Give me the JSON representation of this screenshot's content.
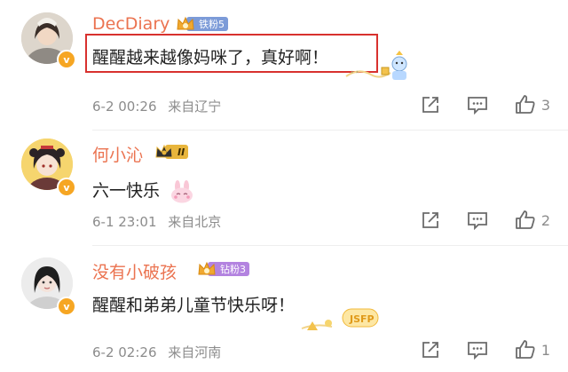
{
  "comments": [
    {
      "username": "DecDiary",
      "fan_badge": "铁粉5",
      "text": "醒醒越来越像妈咪了，真好啊！",
      "time": "6-2 00:26",
      "location": "来自辽宁",
      "likes": "3",
      "badge_color": "#7c9bd8"
    },
    {
      "username": "何小沁",
      "fan_badge": "II",
      "text": "六一快乐",
      "time": "6-1 23:01",
      "location": "来自北京",
      "likes": "2",
      "badge_color": "#e8b53c"
    },
    {
      "username": "没有小破孩",
      "fan_badge": "钻粉3",
      "text": "醒醒和弟弟儿童节快乐呀！",
      "time": "6-2 02:26",
      "location": "来自河南",
      "likes": "1",
      "badge_color": "#b383e0"
    }
  ],
  "icons": {
    "share": "share-icon",
    "comment": "comment-icon",
    "like": "thumbs-up-icon",
    "verified": "verified-v-icon",
    "emoji": "bunny-emoji-icon"
  }
}
